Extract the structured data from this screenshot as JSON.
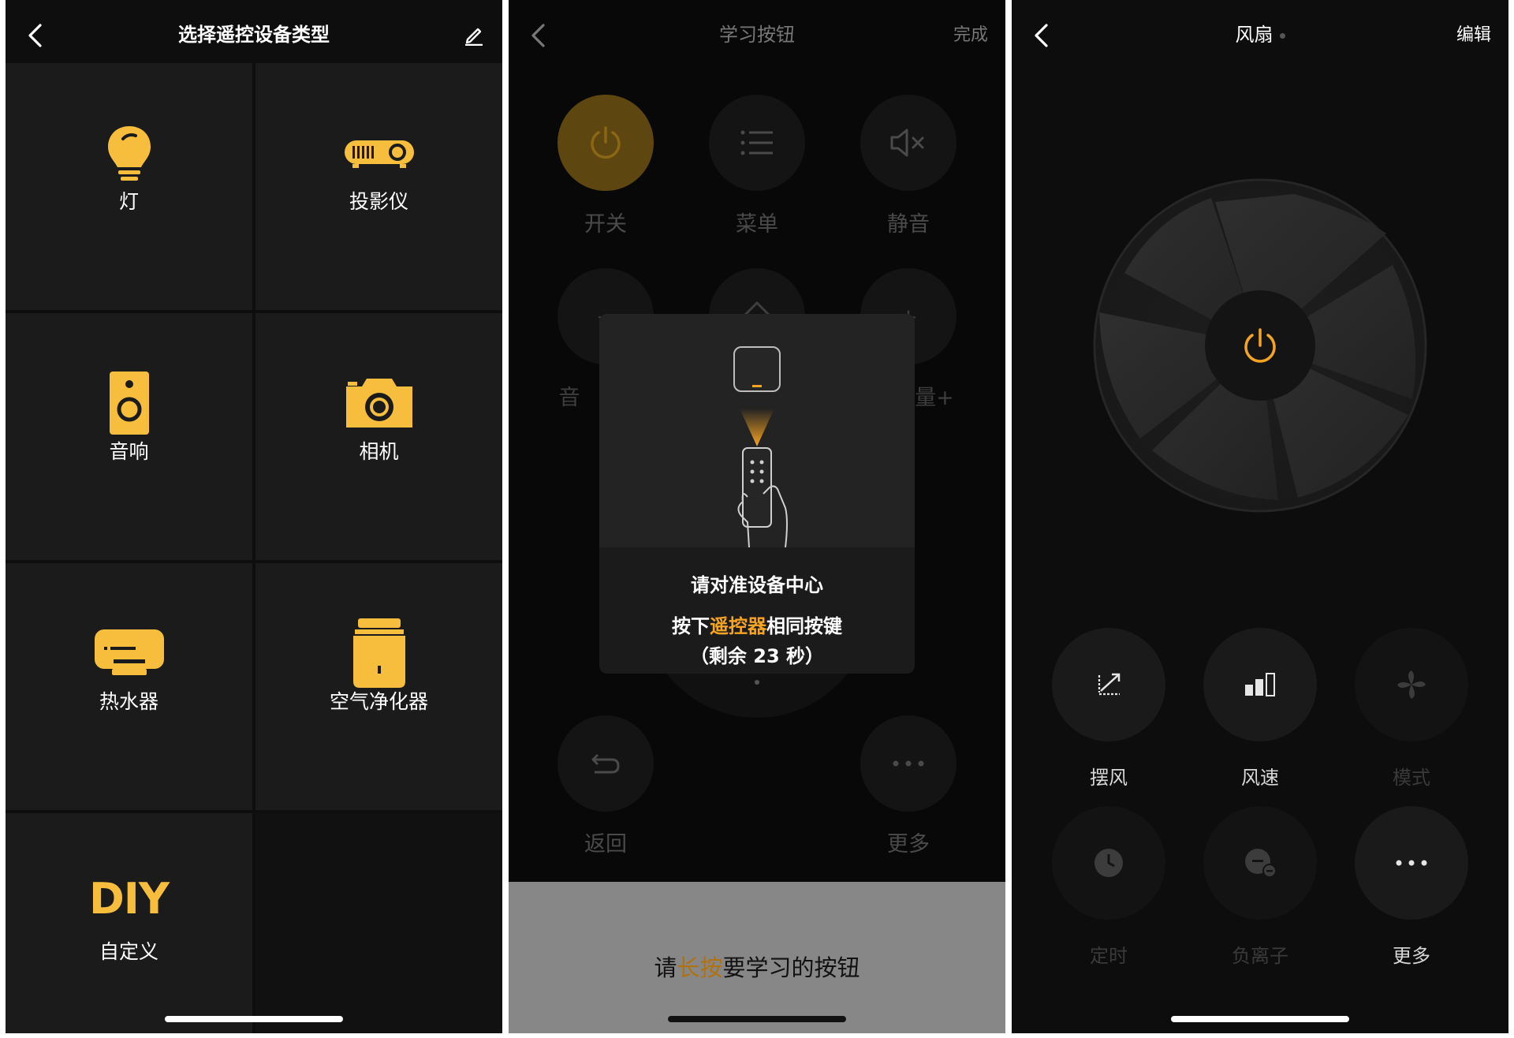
{
  "screen1": {
    "title": "选择遥控设备类型",
    "devices": [
      {
        "label": "灯",
        "icon": "bulb-icon"
      },
      {
        "label": "投影仪",
        "icon": "projector-icon"
      },
      {
        "label": "音响",
        "icon": "speaker-icon"
      },
      {
        "label": "相机",
        "icon": "camera-icon"
      },
      {
        "label": "热水器",
        "icon": "water-heater-icon"
      },
      {
        "label": "空气净化器",
        "icon": "air-purifier-icon"
      },
      {
        "label": "自定义",
        "icon": "diy-icon",
        "icon_text": "DIY"
      }
    ],
    "accent": "#f6be3c"
  },
  "screen2": {
    "title": "学习按钮",
    "done": "完成",
    "buttons": {
      "power": "开关",
      "menu": "菜单",
      "mute": "静音",
      "vol_minus_partial": "音",
      "vol_plus_partial": "量+",
      "back": "返回",
      "more": "更多"
    },
    "modal": {
      "line1": "请对准设备中心",
      "line2_pre": "按下",
      "line2_hl": "遥控器",
      "line2_post": "相同按键",
      "line3": "（剩余 23 秒）"
    },
    "bottom": {
      "pre": "请",
      "hl": "长按",
      "post": "要学习的按钮"
    },
    "highlight": "#f6a423"
  },
  "screen3": {
    "title": "风扇",
    "edit": "编辑",
    "controls": [
      {
        "label": "摆风",
        "icon": "swing-icon",
        "enabled": true
      },
      {
        "label": "风速",
        "icon": "fan-speed-icon",
        "enabled": true
      },
      {
        "label": "模式",
        "icon": "fan-mode-icon",
        "enabled": false
      },
      {
        "label": "定时",
        "icon": "clock-icon",
        "enabled": false
      },
      {
        "label": "负离子",
        "icon": "anion-icon",
        "enabled": false
      },
      {
        "label": "更多",
        "icon": "more-icon",
        "enabled": true
      }
    ],
    "power_color": "#f6a423"
  }
}
